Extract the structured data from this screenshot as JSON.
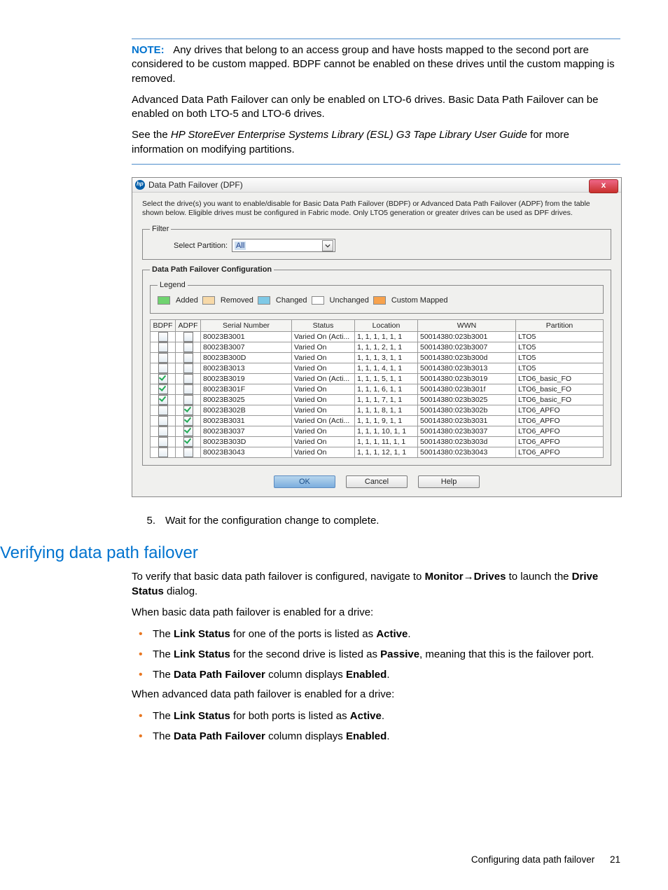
{
  "note": {
    "label": "NOTE:",
    "para1": "Any drives that belong to an access group and have hosts mapped to the second port are considered to be custom mapped. BDPF cannot be enabled on these drives until the custom mapping is removed.",
    "para2": "Advanced Data Path Failover can only be enabled on LTO-6 drives. Basic Data Path Failover can be enabled on both LTO-5 and LTO-6 drives.",
    "para3a": "See the ",
    "para3i": "HP StoreEver Enterprise Systems Library (ESL) G3 Tape Library User Guide",
    "para3b": " for more information on modifying partitions."
  },
  "dialog": {
    "title": "Data Path Failover (DPF)",
    "close_glyph": "x",
    "instructions": "Select the drive(s) you want to enable/disable for Basic Data Path Failover (BDPF) or Advanced Data Path Failover (ADPF) from the table shown below. Eligible drives must be configured in Fabric mode. Only LTO5 generation or greater drives can be used as DPF drives.",
    "filter": {
      "legend": "Filter",
      "label": "Select Partition:",
      "value": "All"
    },
    "config_legend": "Data Path Failover Configuration",
    "legend_title": "Legend",
    "legend_items": {
      "added": "Added",
      "removed": "Removed",
      "changed": "Changed",
      "unchanged": "Unchanged",
      "custom": "Custom Mapped"
    },
    "columns": {
      "bdpf": "BDPF",
      "adpf": "ADPF",
      "serial": "Serial Number",
      "status": "Status",
      "location": "Location",
      "wwn": "WWN",
      "partition": "Partition"
    },
    "rows": [
      {
        "bdpf": false,
        "adpf": false,
        "serial": "80023B3001",
        "status": "Varied On (Acti...",
        "location": "1, 1, 1, 1, 1, 1",
        "wwn": "50014380:023b3001",
        "partition": "LTO5"
      },
      {
        "bdpf": false,
        "adpf": false,
        "serial": "80023B3007",
        "status": "Varied On",
        "location": "1, 1, 1, 2, 1, 1",
        "wwn": "50014380:023b3007",
        "partition": "LTO5"
      },
      {
        "bdpf": false,
        "adpf": false,
        "serial": "80023B300D",
        "status": "Varied On",
        "location": "1, 1, 1, 3, 1, 1",
        "wwn": "50014380:023b300d",
        "partition": "LTO5"
      },
      {
        "bdpf": false,
        "adpf": false,
        "serial": "80023B3013",
        "status": "Varied On",
        "location": "1, 1, 1, 4, 1, 1",
        "wwn": "50014380:023b3013",
        "partition": "LTO5"
      },
      {
        "bdpf": true,
        "adpf": false,
        "serial": "80023B3019",
        "status": "Varied On (Acti...",
        "location": "1, 1, 1, 5, 1, 1",
        "wwn": "50014380:023b3019",
        "partition": "LTO6_basic_FO"
      },
      {
        "bdpf": true,
        "adpf": false,
        "serial": "80023B301F",
        "status": "Varied On",
        "location": "1, 1, 1, 6, 1, 1",
        "wwn": "50014380:023b301f",
        "partition": "LTO6_basic_FO"
      },
      {
        "bdpf": true,
        "adpf": false,
        "serial": "80023B3025",
        "status": "Varied On",
        "location": "1, 1, 1, 7, 1, 1",
        "wwn": "50014380:023b3025",
        "partition": "LTO6_basic_FO"
      },
      {
        "bdpf": false,
        "adpf": true,
        "serial": "80023B302B",
        "status": "Varied On",
        "location": "1, 1, 1, 8, 1, 1",
        "wwn": "50014380:023b302b",
        "partition": "LTO6_APFO"
      },
      {
        "bdpf": false,
        "adpf": true,
        "serial": "80023B3031",
        "status": "Varied On (Acti...",
        "location": "1, 1, 1, 9, 1, 1",
        "wwn": "50014380:023b3031",
        "partition": "LTO6_APFO"
      },
      {
        "bdpf": false,
        "adpf": true,
        "serial": "80023B3037",
        "status": "Varied On",
        "location": "1, 1, 1, 10, 1, 1",
        "wwn": "50014380:023b3037",
        "partition": "LTO6_APFO"
      },
      {
        "bdpf": false,
        "adpf": true,
        "serial": "80023B303D",
        "status": "Varied On",
        "location": "1, 1, 1, 11, 1, 1",
        "wwn": "50014380:023b303d",
        "partition": "LTO6_APFO"
      },
      {
        "bdpf": false,
        "adpf": false,
        "serial": "80023B3043",
        "status": "Varied On",
        "location": "1, 1, 1, 12, 1, 1",
        "wwn": "50014380:023b3043",
        "partition": "LTO6_APFO"
      }
    ],
    "buttons": {
      "ok": "OK",
      "cancel": "Cancel",
      "help": "Help"
    }
  },
  "step5": {
    "num": "5.",
    "text": "Wait for the configuration change to complete."
  },
  "section_heading": "Verifying data path failover",
  "verify": {
    "p1a": "To verify that basic data path failover is configured, navigate to ",
    "p1b": "Monitor",
    "p1arrow": "→",
    "p1c": "Drives",
    "p1d": " to launch the ",
    "p1e": "Drive Status",
    "p1f": " dialog.",
    "p2": "When basic data path failover is enabled for a drive:",
    "b1a": "The ",
    "b1b": "Link Status",
    "b1c": " for one of the ports is listed as ",
    "b1d": "Active",
    "b1e": ".",
    "b2a": "The ",
    "b2b": "Link Status",
    "b2c": " for the second drive is listed as ",
    "b2d": "Passive",
    "b2e": ", meaning that this is the failover port.",
    "b3a": "The ",
    "b3b": "Data Path Failover",
    "b3c": " column displays ",
    "b3d": "Enabled",
    "b3e": ".",
    "p3": "When advanced data path failover is enabled for a drive:",
    "b4a": "The ",
    "b4b": "Link Status",
    "b4c": " for both ports is listed as ",
    "b4d": "Active",
    "b4e": ".",
    "b5a": "The ",
    "b5b": "Data Path Failover",
    "b5c": " column displays ",
    "b5d": "Enabled",
    "b5e": "."
  },
  "footer": {
    "text": "Configuring data path failover",
    "page": "21"
  }
}
